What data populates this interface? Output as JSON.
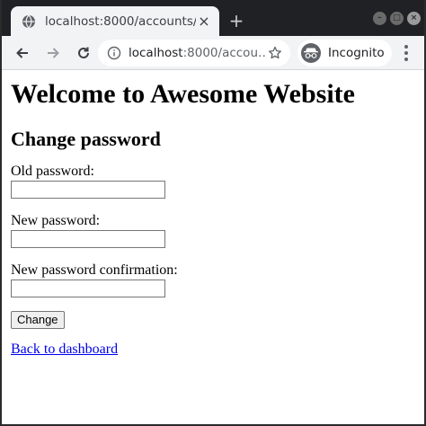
{
  "browser": {
    "tab_title": "localhost:8000/accounts/",
    "tab_close": "×",
    "new_tab": "+",
    "url_host": "localhost",
    "url_path": ":8000/accou…",
    "incognito_label": "Incognito"
  },
  "page": {
    "site_title": "Welcome to Awesome Website",
    "heading": "Change password",
    "fields": [
      {
        "label": "Old password:",
        "value": ""
      },
      {
        "label": "New password:",
        "value": ""
      },
      {
        "label": "New password confirmation:",
        "value": ""
      }
    ],
    "submit_label": "Change",
    "back_link": "Back to dashboard"
  },
  "colors": {
    "link": "#0000ee",
    "titlebar": "#202124",
    "toolbar": "#f1f3f4"
  }
}
